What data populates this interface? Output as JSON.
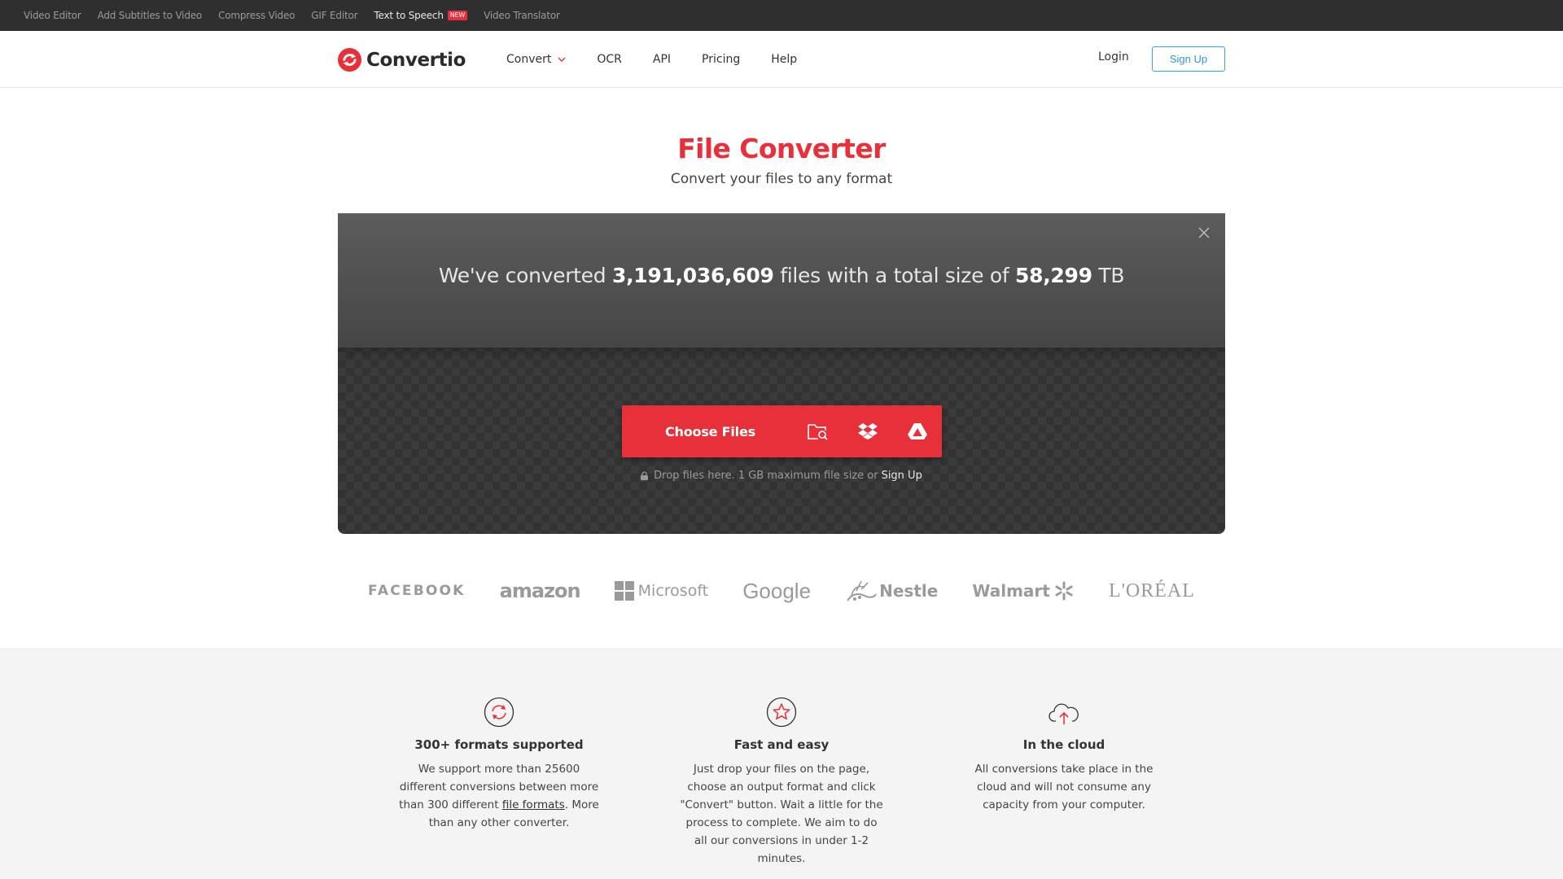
{
  "topbar": {
    "links": [
      "Video Editor",
      "Add Subtitles to Video",
      "Compress Video",
      "GIF Editor",
      "Text to Speech",
      "Video Translator"
    ],
    "new_badge": "NEW"
  },
  "header": {
    "brand": "Convertio",
    "nav": [
      "Convert",
      "OCR",
      "API",
      "Pricing",
      "Help"
    ],
    "login": "Login",
    "signup": "Sign Up"
  },
  "hero": {
    "title": "File Converter",
    "subtitle": "Convert your files to any format"
  },
  "stats": {
    "prefix": "We've converted",
    "files_count": "3,191,036,609",
    "middle": "files with a total size of",
    "size": "58,299",
    "unit": "TB"
  },
  "upload": {
    "choose_label": "Choose Files",
    "drop_text": "Drop files here. 1 GB maximum file size or",
    "drop_link": "Sign Up"
  },
  "brands": [
    "FACEBOOK",
    "amazon",
    "Microsoft",
    "Google",
    "Nestle",
    "Walmart",
    "L'ORÉAL"
  ],
  "features": [
    {
      "title": "300+ formats supported",
      "text_before": "We support more than 25600 different conversions between more than 300 different",
      "link": "file formats",
      "text_after": ". More than any other converter."
    },
    {
      "title": "Fast and easy",
      "text": "Just drop your files on the page, choose an output format and click \"Convert\" button. Wait a little for the process to complete. We aim to do all our conversions in under 1-2 minutes."
    },
    {
      "title": "In the cloud",
      "text": "All conversions take place in the cloud and will not consume any capacity from your computer."
    }
  ],
  "colors": {
    "accent": "#e8303a",
    "signup_border": "#36a6d9",
    "topbar_bg": "#2f2f2f",
    "upload_bg": "#333333"
  }
}
